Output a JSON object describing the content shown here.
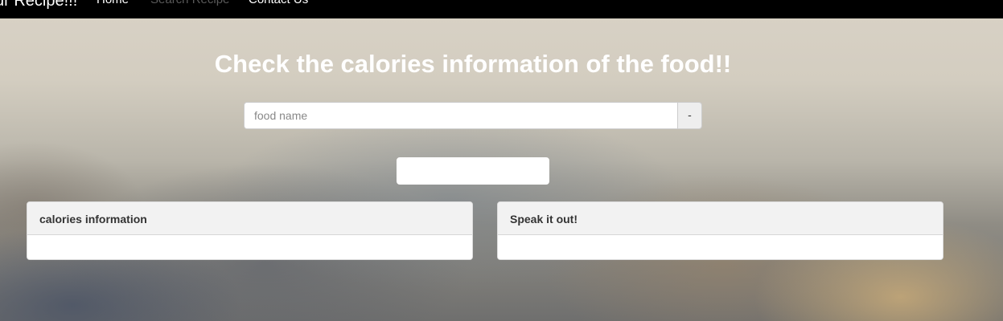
{
  "navbar": {
    "brand": "ur Recipe!!!",
    "links": [
      "Home",
      "Search Recipe",
      "Contact Us"
    ]
  },
  "main": {
    "title": "Check the calories information of the food!!",
    "search": {
      "placeholder": "food name",
      "value": "",
      "addon_label": "-"
    },
    "submit_label": ""
  },
  "panels": [
    {
      "heading": "calories information",
      "body": ""
    },
    {
      "heading": "Speak it out!",
      "body": ""
    }
  ],
  "colors": {
    "navbar": "#000000",
    "nav_active_text": "#ffffff",
    "nav_muted_text": "#5a5a5a",
    "panel_heading_bg": "#f2f2f2"
  }
}
